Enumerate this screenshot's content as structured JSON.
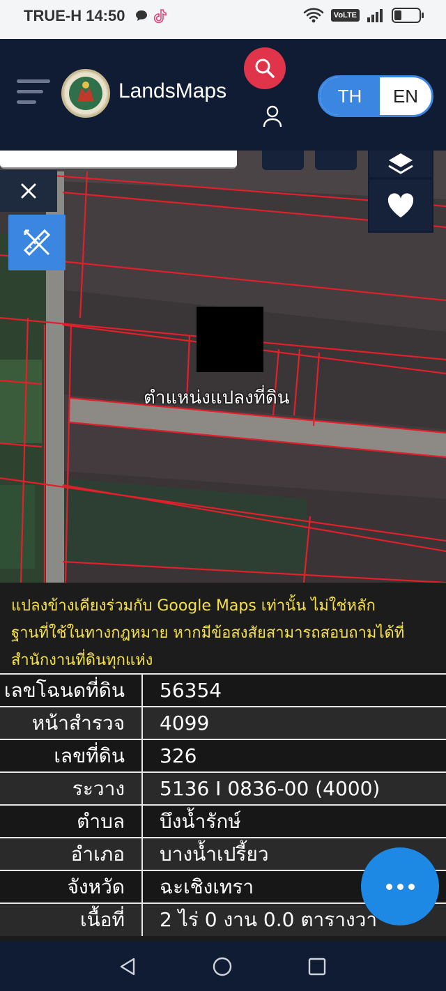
{
  "status_bar": {
    "carrier_time": "TRUE-H 14:50",
    "volte": "VoLTE",
    "battery_level": 0.3
  },
  "header": {
    "app_name": "LandsMaps",
    "lang_th": "TH",
    "lang_en": "EN",
    "active_lang": "TH"
  },
  "map": {
    "parcel_label": "ตำแหน่งแปลงที่ดิน"
  },
  "info": {
    "disclaimer_lines": [
      "แปลงข้างเคียงร่วมกับ Google Maps เท่านั้น ไม่ใช่หลัก",
      "ฐานที่ใช้ในทางกฎหมาย หากมีข้อสงสัยสามารถสอบถามได้ที่",
      "สำนักงานที่ดินทุกแห่ง"
    ],
    "rows": [
      {
        "label": "เลขโฉนดที่ดิน",
        "value": "56354"
      },
      {
        "label": "หน้าสำรวจ",
        "value": "4099"
      },
      {
        "label": "เลขที่ดิน",
        "value": "326"
      },
      {
        "label": "ระวาง",
        "value": "5136 I 0836-00 (4000)"
      },
      {
        "label": "ตำบล",
        "value": "บึงน้ำรักษ์"
      },
      {
        "label": "อำเภอ",
        "value": "บางน้ำเปรี้ยว"
      },
      {
        "label": "จังหวัด",
        "value": "ฉะเชิงเทรา"
      },
      {
        "label": "เนื้อที่",
        "value": "2 ไร่ 0 งาน 0.0 ตารางวา"
      }
    ]
  },
  "colors": {
    "header_bg": "#0f1c33",
    "accent_blue": "#3a86e0",
    "search_red": "#e0344b",
    "parcel_line": "#e0202a",
    "disclaimer_yellow": "#f4e04d",
    "fab_blue": "#1e88e5"
  },
  "icons": [
    "wifi-icon",
    "signal-icon",
    "battery-icon",
    "chat-icon",
    "tiktok-icon",
    "menu-icon",
    "search-icon",
    "user-icon",
    "layers-icon",
    "heart-icon",
    "close-icon",
    "ruler-pencil-icon",
    "more-icon",
    "back-icon",
    "home-icon",
    "recents-icon"
  ]
}
